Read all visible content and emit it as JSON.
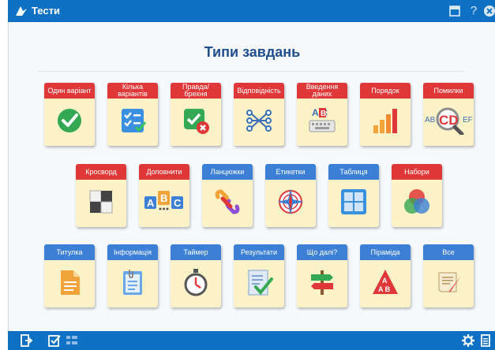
{
  "app": {
    "title": "Тести"
  },
  "page": {
    "heading": "Типи завдань"
  },
  "colors": {
    "header": "#0e71c3",
    "label_red": "#e03838",
    "label_blue": "#3b7fd6",
    "tile": "#fbf3c7",
    "heading": "#1f4f8c"
  },
  "tiles": {
    "one_variant": "Один варіант",
    "multi_variant": "Кілька варіантів",
    "true_false": "Правда/брехня",
    "matching": "Відповідність",
    "data_entry": "Введення даних",
    "order": "Порядок",
    "errors": "Помилки",
    "crossword": "Кросворд",
    "complete": "Доповнити",
    "chains": "Ланцюжки",
    "labels": "Етикетки",
    "table": "Таблиця",
    "sets": "Набори",
    "title_page": "Титулка",
    "info": "Інформація",
    "timer": "Таймер",
    "results": "Результати",
    "whats_next": "Що далі?",
    "pyramid": "Піраміда",
    "all": "Все"
  },
  "icon_text": {
    "data_entry_letters": "A  C",
    "data_entry_box": "B",
    "errors_text": "CD",
    "errors_left": "AB",
    "errors_right": "EF",
    "complete_a": "A",
    "complete_b": "B",
    "complete_c": "C",
    "pyramid_a": "A",
    "pyramid_b": "A B"
  }
}
